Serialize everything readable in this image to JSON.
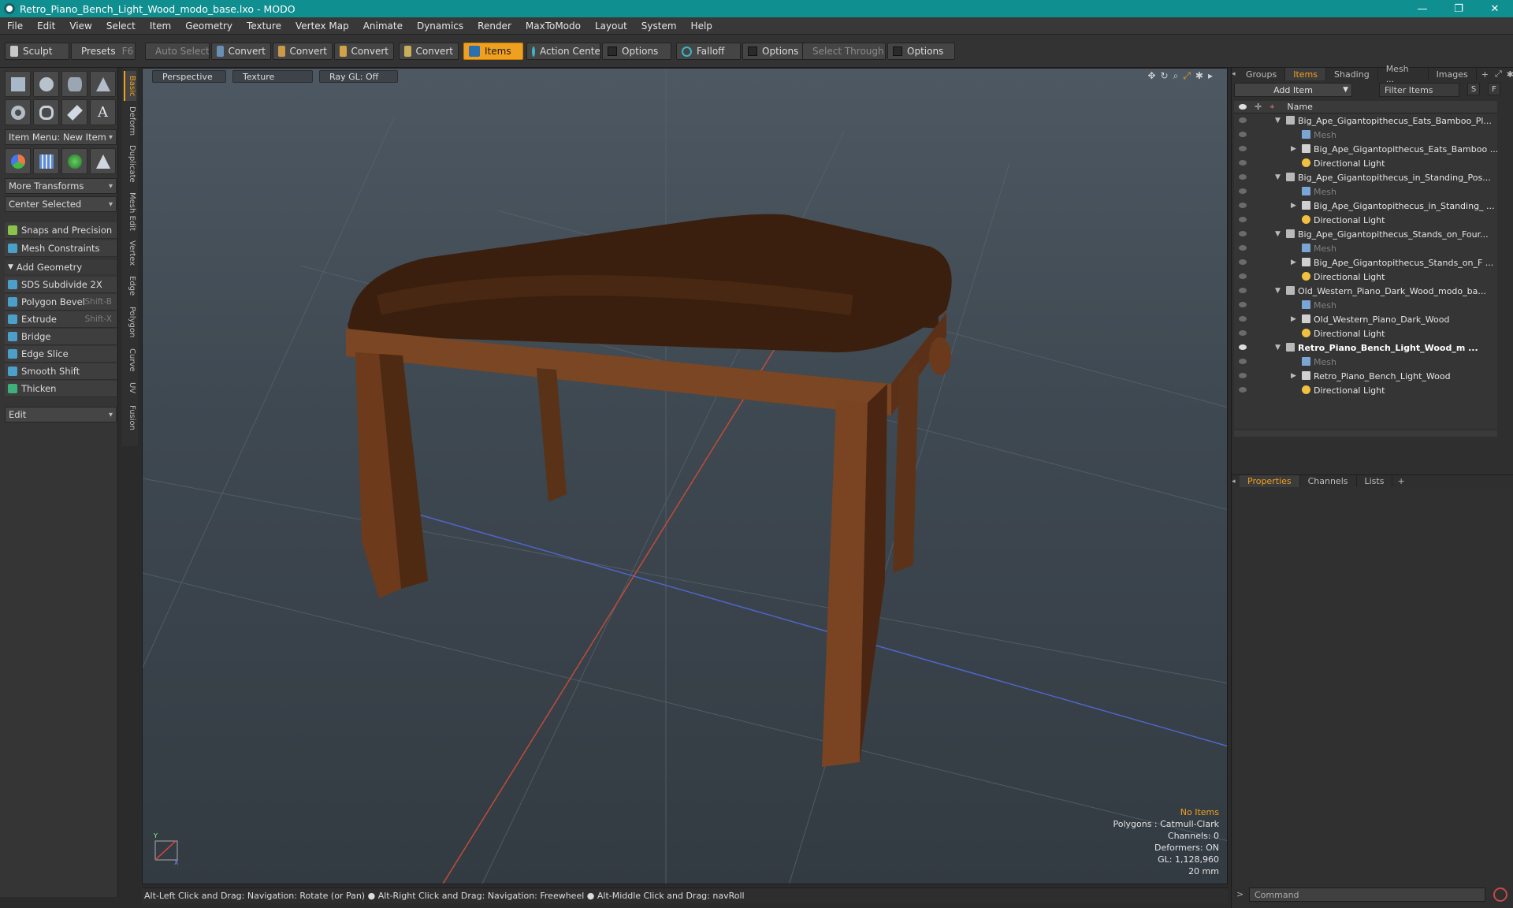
{
  "window": {
    "title": "Retro_Piano_Bench_Light_Wood_modo_base.lxo - MODO",
    "min": "—",
    "max": "❐",
    "close": "✕"
  },
  "menu": [
    "File",
    "Edit",
    "View",
    "Select",
    "Item",
    "Geometry",
    "Texture",
    "Vertex Map",
    "Animate",
    "Dynamics",
    "Render",
    "MaxToModo",
    "Layout",
    "System",
    "Help"
  ],
  "toolbar": {
    "sculpt": "Sculpt",
    "presets": "Presets",
    "presets_key": "F6",
    "auto_select": "Auto Select",
    "convert1": "Convert",
    "convert2": "Convert",
    "convert3": "Convert",
    "convert4": "Convert",
    "items": "Items",
    "action_center": "Action Center",
    "options1": "Options",
    "falloff": "Falloff",
    "options2": "Options",
    "select_through": "Select Through",
    "options3": "Options"
  },
  "left": {
    "item_menu": "Item Menu: New Item",
    "more_transforms": "More Transforms",
    "center_selected": "Center Selected",
    "snaps": "Snaps and Precision",
    "mesh_constraints": "Mesh Constraints",
    "add_geometry": "Add Geometry",
    "tools": [
      {
        "label": "SDS Subdivide 2X",
        "key": ""
      },
      {
        "label": "Polygon Bevel",
        "key": "Shift-B"
      },
      {
        "label": "Extrude",
        "key": "Shift-X"
      },
      {
        "label": "Bridge",
        "key": ""
      },
      {
        "label": "Edge Slice",
        "key": ""
      },
      {
        "label": "Smooth Shift",
        "key": ""
      },
      {
        "label": "Thicken",
        "key": ""
      }
    ],
    "edit_dropdown": "Edit",
    "vtabs": [
      "Basic",
      "Deform",
      "Duplicate",
      "Mesh Edit",
      "Vertex",
      "Edge",
      "Polygon",
      "Curve",
      "UV",
      "Fusion"
    ]
  },
  "viewport": {
    "perspective": "Perspective",
    "texture": "Texture",
    "raygl": "Ray GL: Off",
    "info": {
      "no_items": "No Items",
      "polygons": "Polygons : Catmull-Clark",
      "channels": "Channels: 0",
      "deformers": "Deformers: ON",
      "gl": "GL: 1,128,960",
      "scale": "20 mm"
    }
  },
  "status": "Alt-Left Click and Drag: Navigation: Rotate (or Pan) ● Alt-Right Click and Drag: Navigation: Freewheel ● Alt-Middle Click and Drag: navRoll",
  "right": {
    "tabs": [
      "Groups",
      "Items",
      "Shading",
      "Mesh ...",
      "Images"
    ],
    "add_item": "Add Item",
    "filter": "Filter Items",
    "s": "S",
    "f": "F",
    "name_col": "Name",
    "tree": [
      {
        "label": "Big_Ape_Gigantopithecus_Eats_Bamboo_Pl...",
        "level": 0,
        "type": "scene",
        "expanded": true
      },
      {
        "label": "Mesh",
        "level": 1,
        "type": "mesh",
        "dim": true
      },
      {
        "label": "Big_Ape_Gigantopithecus_Eats_Bamboo ...",
        "level": 1,
        "type": "group",
        "collapsed": true
      },
      {
        "label": "Directional Light",
        "level": 1,
        "type": "light"
      },
      {
        "label": "Big_Ape_Gigantopithecus_in_Standing_Pos...",
        "level": 0,
        "type": "scene",
        "expanded": true
      },
      {
        "label": "Mesh",
        "level": 1,
        "type": "mesh",
        "dim": true
      },
      {
        "label": "Big_Ape_Gigantopithecus_in_Standing_ ...",
        "level": 1,
        "type": "group",
        "collapsed": true
      },
      {
        "label": "Directional Light",
        "level": 1,
        "type": "light"
      },
      {
        "label": "Big_Ape_Gigantopithecus_Stands_on_Four...",
        "level": 0,
        "type": "scene",
        "expanded": true
      },
      {
        "label": "Mesh",
        "level": 1,
        "type": "mesh",
        "dim": true
      },
      {
        "label": "Big_Ape_Gigantopithecus_Stands_on_F ...",
        "level": 1,
        "type": "group",
        "collapsed": true
      },
      {
        "label": "Directional Light",
        "level": 1,
        "type": "light"
      },
      {
        "label": "Old_Western_Piano_Dark_Wood_modo_ba...",
        "level": 0,
        "type": "scene",
        "expanded": true
      },
      {
        "label": "Mesh",
        "level": 1,
        "type": "mesh",
        "dim": true
      },
      {
        "label": "Old_Western_Piano_Dark_Wood",
        "level": 1,
        "type": "group",
        "collapsed": true
      },
      {
        "label": "Directional Light",
        "level": 1,
        "type": "light"
      },
      {
        "label": "Retro_Piano_Bench_Light_Wood_m ...",
        "level": 0,
        "type": "scene",
        "expanded": true,
        "bold": true
      },
      {
        "label": "Mesh",
        "level": 1,
        "type": "mesh",
        "dim": true
      },
      {
        "label": "Retro_Piano_Bench_Light_Wood",
        "level": 1,
        "type": "group",
        "collapsed": true
      },
      {
        "label": "Directional Light",
        "level": 1,
        "type": "light"
      }
    ],
    "prop_tabs": [
      "Properties",
      "Channels",
      "Lists"
    ],
    "command": "Command"
  }
}
